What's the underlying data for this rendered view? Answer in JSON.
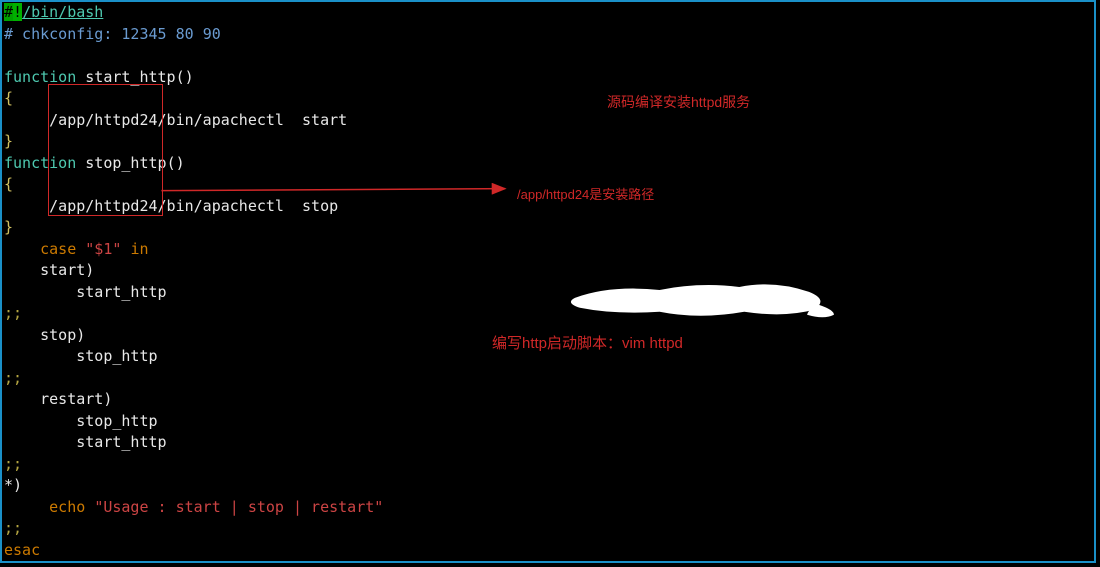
{
  "shebang": {
    "hash": "#",
    "bang": "!",
    "path": "/bin/bash"
  },
  "chkconfig_line": {
    "prefix": "# chkconfig: ",
    "levels": "12345",
    "start_prio": "80",
    "stop_prio": "90"
  },
  "func_start": {
    "keyword": "function",
    "name": "start_http",
    "parens": "()",
    "open": "{",
    "body_path": "/app/httpd24/bin/apachectl",
    "body_arg": "start",
    "close": "}"
  },
  "func_stop": {
    "keyword": "function",
    "name": "stop_http",
    "parens": "()",
    "open": "{",
    "body_path": "/app/httpd24/bin/apachectl",
    "body_arg": "stop",
    "close": "}"
  },
  "case_block": {
    "case": "case",
    "var": "\"$1\"",
    "in": "in",
    "branch_start": {
      "label": "start)",
      "call": "start_http"
    },
    "sep": ";;",
    "branch_stop": {
      "label": "stop)",
      "call": "stop_http"
    },
    "branch_restart": {
      "label": "restart)",
      "call1": "stop_http",
      "call2": "start_http"
    },
    "branch_default": {
      "label": "*)",
      "echo": "echo",
      "msg": "\"Usage : start | stop | restart\""
    },
    "esac": "esac"
  },
  "annotations": {
    "top_right": "源码编译安装httpd服务",
    "arrow_label": "/app/httpd24是安装路径",
    "bottom": "编写http启动脚本：vim httpd"
  }
}
